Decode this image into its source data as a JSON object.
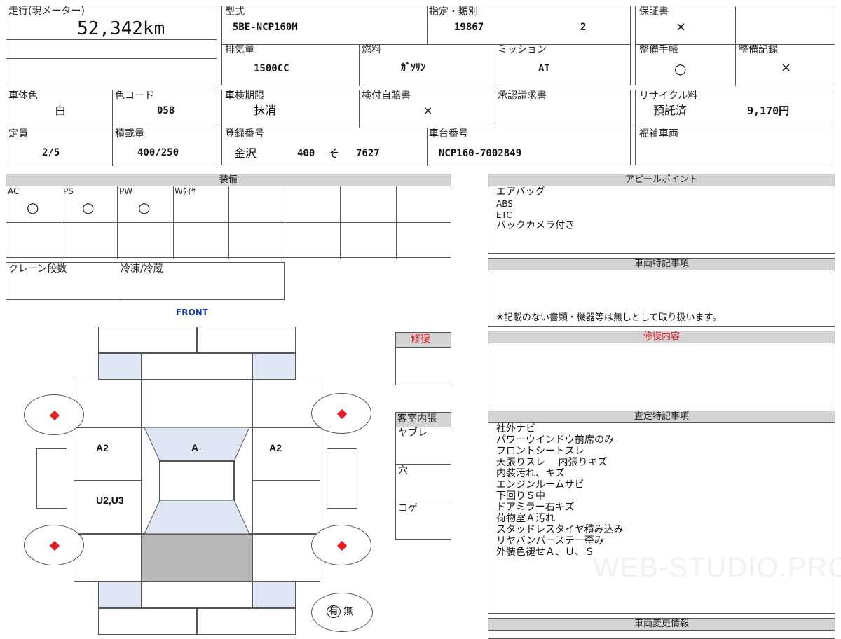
{
  "top": {
    "mileage_label": "走行(現メーター)",
    "mileage_value": "52,342km",
    "model_label": "型式",
    "model_value": "5BE-NCP160M",
    "designation_label": "指定・類別",
    "designation_value": "19867",
    "class_value": "2",
    "warranty_label": "保証書",
    "warranty_value": "×",
    "displacement_label": "排気量",
    "displacement_value": "1500CC",
    "fuel_label": "燃料",
    "fuel_value": "ｶﾞｿﾘﾝ",
    "transmission_label": "ミッション",
    "transmission_value": "AT",
    "maintenance_book_label": "整備手帳",
    "maintenance_book_value": "○",
    "maintenance_record_label": "整備記録",
    "maintenance_record_value": "×"
  },
  "second": {
    "body_color_label": "車体色",
    "body_color_value": "白",
    "color_code_label": "色コード",
    "color_code_value": "058",
    "inspection_label": "車検期限",
    "inspection_value": "抹消",
    "insurance_label": "検付自賠書",
    "insurance_value": "×",
    "approval_label": "承認請求書",
    "recycle_label": "リサイクル料",
    "recycle_status": "預託済",
    "recycle_amount": "9,170円",
    "capacity_label": "定員",
    "capacity_value": "2/5",
    "load_label": "積載量",
    "load_value": "400/250",
    "registration_label": "登録番号",
    "registration_city": "金沢",
    "registration_num": "400",
    "registration_kana": "そ",
    "registration_no": "7627",
    "chassis_label": "車台番号",
    "chassis_value": "NCP160-7002849",
    "welfare_label": "福祉車両"
  },
  "equipment": {
    "header": "装備",
    "items": [
      {
        "label": "AC",
        "value": "○"
      },
      {
        "label": "PS",
        "value": "○"
      },
      {
        "label": "PW",
        "value": "○"
      },
      {
        "label": "Wﾀｲﾔ",
        "value": ""
      }
    ],
    "crane_label": "クレーン段数",
    "freezer_label": "冷凍/冷蔵"
  },
  "appeal": {
    "header": "アピールポイント",
    "lines": [
      "エアバッグ",
      "ABS",
      "ETC",
      "バックカメラ付き"
    ]
  },
  "vehicle_notes": {
    "header": "車両特記事項",
    "footnote": "※記載のない書類・機器等は無しとして取り扱います。"
  },
  "repair_content": {
    "header": "修復内容"
  },
  "assessment": {
    "header": "査定特記事項",
    "lines": [
      "社外ナビ",
      "パワーウインドウ前席のみ",
      "フロントシートスレ",
      "天張りスレ　 内張りキズ",
      "内装汚れ、キズ",
      "エンジンルームサビ",
      "下回りＳ中",
      "ドアミラー右キズ",
      "荷物室Ａ汚れ",
      "スタッドレスタイヤ積み込み",
      "リヤバンパーステー歪み",
      "外装色褪せＡ、Ｕ、Ｓ"
    ]
  },
  "change_info": {
    "header": "車両変更情報"
  },
  "repair": {
    "label": "修復"
  },
  "interior": {
    "header": "客室内張",
    "rows": [
      "ヤブレ",
      "穴",
      "コゲ"
    ]
  },
  "diagram": {
    "front_label": "FRONT",
    "front_color": "#1a3aa8",
    "left_panel": "A2",
    "roof_panel": "A",
    "right_panel": "A2",
    "side_note": "U2,U3",
    "has_label": "有",
    "none_label": "無",
    "repair_color": "#e31b23"
  },
  "watermark": "WEB-STUDIO.PRO"
}
